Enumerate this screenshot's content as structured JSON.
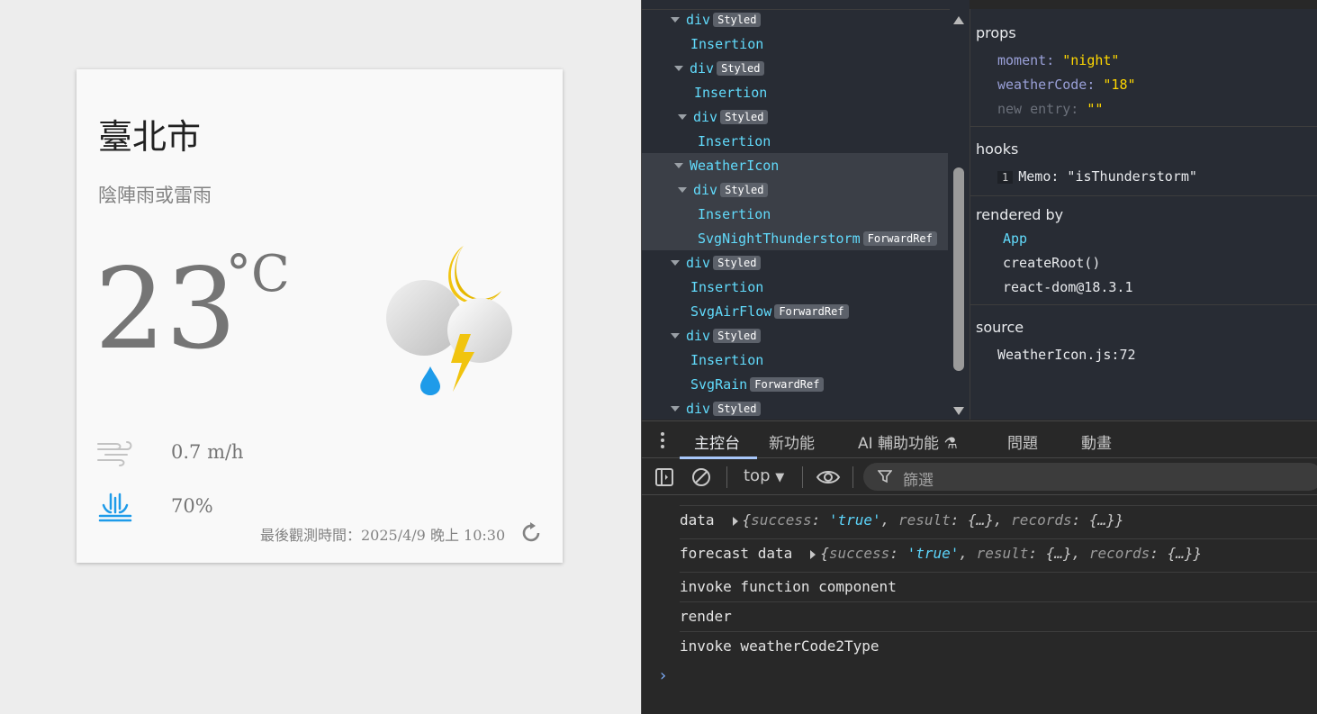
{
  "weather": {
    "location": "臺北市",
    "description": "陰陣雨或雷雨",
    "temperature": "23",
    "unit": "°C",
    "wind": "0.7 m/h",
    "rain": "70%",
    "observed": "最後觀測時間：2025/4/9 晚上 10:30",
    "icon": "night-thunderstorm-icon"
  },
  "tree": {
    "nodes": [
      {
        "name": "div",
        "badge": "Styled"
      },
      {
        "name": "Insertion",
        "badge": ""
      },
      {
        "name": "div",
        "badge": "Styled"
      },
      {
        "name": "Insertion",
        "badge": ""
      },
      {
        "name": "div",
        "badge": "Styled"
      },
      {
        "name": "Insertion",
        "badge": ""
      },
      {
        "name": "WeatherIcon",
        "badge": ""
      },
      {
        "name": "div",
        "badge": "Styled"
      },
      {
        "name": "Insertion",
        "badge": ""
      },
      {
        "name": "SvgNightThunderstorm",
        "badge": "ForwardRef"
      },
      {
        "name": "div",
        "badge": "Styled"
      },
      {
        "name": "Insertion",
        "badge": ""
      },
      {
        "name": "SvgAirFlow",
        "badge": "ForwardRef"
      },
      {
        "name": "div",
        "badge": "Styled"
      },
      {
        "name": "Insertion",
        "badge": ""
      },
      {
        "name": "SvgRain",
        "badge": "ForwardRef"
      },
      {
        "name": "div",
        "badge": "Styled"
      }
    ]
  },
  "inspector": {
    "props_title": "props",
    "props": [
      {
        "key": "moment",
        "value": "\"night\""
      },
      {
        "key": "weatherCode",
        "value": "\"18\""
      },
      {
        "key": "new entry",
        "value": "\"\""
      }
    ],
    "hooks_title": "hooks",
    "hook_index": "1",
    "hook": "Memo: \"isThunderstorm\"",
    "rendered_title": "rendered by",
    "rendered": [
      "App",
      "createRoot()",
      "react-dom@18.3.1"
    ],
    "source_title": "source",
    "source": "WeatherIcon.js:72"
  },
  "console": {
    "tabs": [
      "主控台",
      "新功能",
      "AI 輔助功能",
      "問題",
      "動畫"
    ],
    "context": "top",
    "filter_placeholder": "篩選",
    "rows": [
      {
        "label": "data",
        "obj": true
      },
      {
        "label": "forecast data",
        "obj": true
      },
      {
        "label": "invoke function component",
        "obj": false
      },
      {
        "label": "render",
        "obj": false
      },
      {
        "label": "invoke weatherCode2Type",
        "obj": false
      }
    ],
    "obj_text": {
      "open": "{",
      "k1": "success",
      "v1": "'true'",
      "k2": "result",
      "v2": "{…}",
      "k3": "records",
      "v3": "{…}",
      "close": "}"
    },
    "prompt": "›"
  }
}
